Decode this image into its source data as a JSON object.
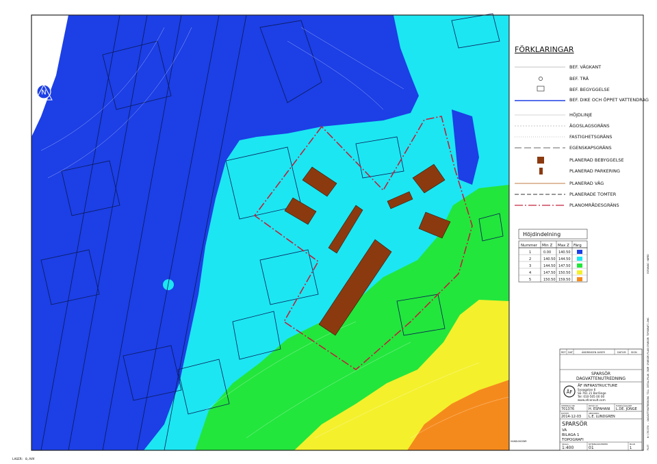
{
  "legend": {
    "title": "FÖRKLARINGAR",
    "items": [
      {
        "label": "BEF. VÄGKANT"
      },
      {
        "label": "BEF. TRÄ"
      },
      {
        "label": "BEF. BEGYGGELSE"
      },
      {
        "label": "BEF. DIKE OCH ÖPPET VATTENDRAG"
      },
      {
        "label": "HÖJDLINJE"
      },
      {
        "label": "ÄGOSLAGSGRÄNS"
      },
      {
        "label": "FASTIGHETSGRÄNS"
      },
      {
        "label": "EGENSKAPSGRÄNS"
      },
      {
        "label": "PLANERAD BEBYGGELSE"
      },
      {
        "label": "PLANERAD PARKERING"
      },
      {
        "label": "PLANERAD VÄG"
      },
      {
        "label": "PLANERADE TOMTER"
      },
      {
        "label": "PLANOMRÅDESGRÄNS"
      }
    ]
  },
  "elevation_table": {
    "title": "Höjdindelning",
    "headers": [
      "Nummer",
      "Min Z",
      "Max Z",
      "Färg"
    ],
    "rows": [
      {
        "nummer": "1",
        "min": "0.00",
        "max": "140.50",
        "color": "#1c3fe6"
      },
      {
        "nummer": "2",
        "min": "140.50",
        "max": "144.50",
        "color": "#1ce6f2"
      },
      {
        "nummer": "3",
        "min": "144.50",
        "max": "147.50",
        "color": "#22e63c"
      },
      {
        "nummer": "4",
        "min": "147.50",
        "max": "150.50",
        "color": "#f4f02c"
      },
      {
        "nummer": "5",
        "min": "150.50",
        "max": "159.50",
        "color": "#f58a1c"
      }
    ]
  },
  "colors": {
    "zone1": "#1c3fe6",
    "zone2": "#1ce6f2",
    "zone3": "#22e63c",
    "zone4": "#f4f02c",
    "zone5": "#f58a1c",
    "building": "#8b3a10",
    "plan_boundary": "#c0203a"
  },
  "title_block": {
    "revision_headers": {
      "ref": "REF",
      "dat": "DAT",
      "change": "ÄNDRINGEN AVSER",
      "date": "DATUM",
      "sign": "SIGN"
    },
    "project_title": "SPARSÖR",
    "project_subtitle": "DAGVATTENUTREDNING",
    "company_name": "ÅF INFRASTRUCTURE",
    "company_address": "Svaagatan 6",
    "company_city": "SE-761 21 Borlänge",
    "company_tel": "Tel: 010-505 00 00",
    "company_web": "www.afconsult.com",
    "uppdrag_label": "UPPDRAG NR",
    "uppdrag_value": "701376",
    "ritad_label": "RITAD AV",
    "ritad_value": "H. ESFAHANI",
    "handlaggare_label": "HANDLÄGGARE",
    "handlaggare_value": "L.DE. JONGE",
    "datum_label": "DATUM",
    "datum_value": "2014-12-03",
    "ansvarig_label": "ANSVARIG",
    "ansvarig_value": "L.E. LUNDGREN",
    "sheet_title": "SPARSÖR",
    "sheet_sub1": "VA",
    "sheet_sub2": "BILAGA 1",
    "sheet_sub3": "TOPOGRAFI",
    "status_label": "HANDLINGSNR",
    "skala_label": "SKALA",
    "skala_value": "1:400",
    "nummer_label": "RITNINGSNUMMER",
    "nummer_value": "01",
    "blad_label": "BLAD",
    "blad_value": "1"
  },
  "side_text": {
    "path": "W:\\701376 - DAGVATTENUTREDNING TILL DETALJPLAN INOM SPARSOR\\PLAN\\SPARSOR TOPOGRAFI.DWG",
    "user": "ESFAHANI HAMED",
    "plot_label": "PLOT",
    "plot_date": "2014-12-05"
  },
  "footer": {
    "layer": "LAGER: 0,AVV"
  }
}
